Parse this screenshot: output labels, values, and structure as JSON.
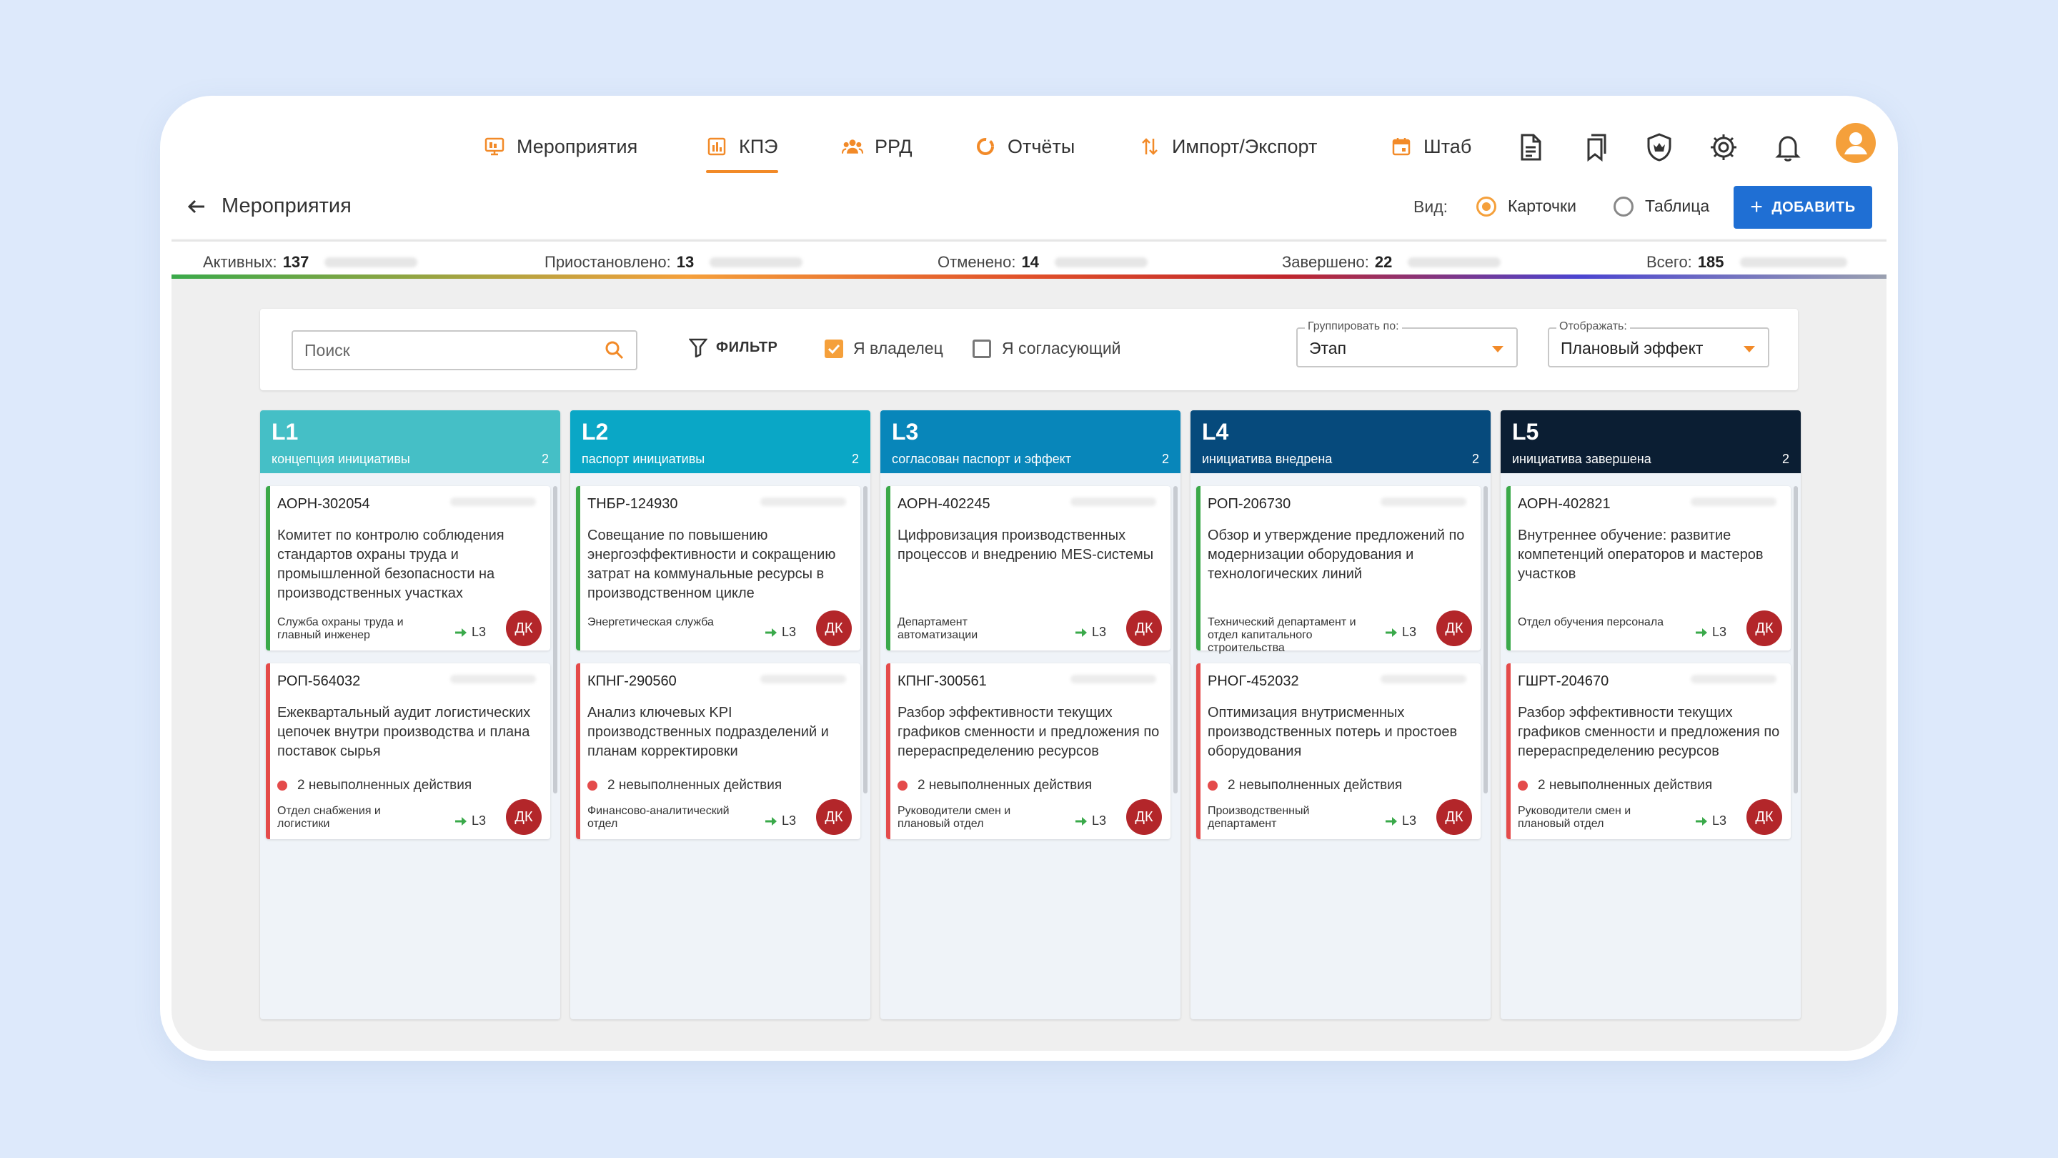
{
  "nav": {
    "items": [
      {
        "label": "Мероприятия",
        "icon": "monitor-icon"
      },
      {
        "label": "КПЭ",
        "icon": "bar-chart-icon"
      },
      {
        "label": "РРД",
        "icon": "team-icon"
      },
      {
        "label": "Отчёты",
        "icon": "pie-chart-icon"
      },
      {
        "label": "Импорт/Экспорт",
        "icon": "import-export-icon"
      },
      {
        "label": "Штаб",
        "icon": "calendar-icon"
      }
    ],
    "active": "КПЭ",
    "icons": [
      "document-icon",
      "bookmarks-icon",
      "shield-crown-icon",
      "settings-icon",
      "bell-icon",
      "user-avatar-icon"
    ]
  },
  "header": {
    "title": "Мероприятия",
    "view_label": "Вид:",
    "view_cards": "Карточки",
    "view_table": "Таблица",
    "view_selected": "Карточки",
    "add_button": "ДОБАВИТЬ"
  },
  "stats": [
    {
      "label": "Активных:",
      "value": "137"
    },
    {
      "label": "Приостановлено:",
      "value": "13"
    },
    {
      "label": "Отменено:",
      "value": "14"
    },
    {
      "label": "Завершено:",
      "value": "22"
    },
    {
      "label": "Всего:",
      "value": "185"
    }
  ],
  "filters": {
    "search_placeholder": "Поиск",
    "filter_button": "ФИЛЬТР",
    "owner_label": "Я владелец",
    "owner_checked": true,
    "approver_label": "Я согласующий",
    "approver_checked": false,
    "group_by_label": "Группировать по:",
    "group_by_value": "Этап",
    "display_label": "Отображать:",
    "display_value": "Плановый эффект"
  },
  "columns": [
    {
      "code": "L1",
      "subtitle": "концепция инициативы",
      "count": "2",
      "color": "#45bfc6",
      "cards": [
        {
          "code": "АОРН-302054",
          "desc": "Комитет по контролю соблюдения стандартов охраны труда и промышленной безопасности на производственных участках",
          "dept": "Служба охраны труда и главный инженер",
          "level": "L3",
          "avatar": "ДК",
          "status_color": "#3aa94a",
          "warning": ""
        },
        {
          "code": "РОП-564032",
          "desc": "Ежеквартальный аудит логистических цепочек внутри производства и плана поставок сырья",
          "dept": "Отдел снабжения и логистики",
          "level": "L3",
          "avatar": "ДК",
          "status_color": "#e44b4b",
          "warning": "2 невыполненных действия"
        }
      ]
    },
    {
      "code": "L2",
      "subtitle": "паспорт инициативы",
      "count": "2",
      "color": "#0aa7c6",
      "cards": [
        {
          "code": "ТНБР-124930",
          "desc": "Совещание по повышению энергоэффективности и сокращению затрат на коммунальные ресурсы в производственном цикле",
          "dept": "Энергетическая служба",
          "level": "L3",
          "avatar": "ДК",
          "status_color": "#3aa94a",
          "warning": ""
        },
        {
          "code": "КПНГ-290560",
          "desc": "Анализ ключевых KPI производственных подразделений и планам корректировки",
          "dept": "Финансово-аналитический отдел",
          "level": "L3",
          "avatar": "ДК",
          "status_color": "#e44b4b",
          "warning": "2 невыполненных действия"
        }
      ]
    },
    {
      "code": "L3",
      "subtitle": "согласован паспорт и эффект",
      "count": "2",
      "color": "#0886ba",
      "cards": [
        {
          "code": "АОРН-402245",
          "desc": "Цифровизация производственных процессов и внедрению MES-системы",
          "dept": "Департамент автоматизации",
          "level": "L3",
          "avatar": "ДК",
          "status_color": "#3aa94a",
          "warning": ""
        },
        {
          "code": "КПНГ-300561",
          "desc": "Разбор эффективности текущих графиков сменности и предложения по перераспределению ресурсов",
          "dept": "Руководители смен и плановый отдел",
          "level": "L3",
          "avatar": "ДК",
          "status_color": "#e44b4b",
          "warning": "2 невыполненных действия"
        }
      ]
    },
    {
      "code": "L4",
      "subtitle": "инициатива внедрена",
      "count": "2",
      "color": "#064a7c",
      "cards": [
        {
          "code": "РОП-206730",
          "desc": "Обзор и утверждение предложений по модернизации оборудования и технологических линий",
          "dept": "Технический департамент и отдел капитального строительства",
          "level": "L3",
          "avatar": "ДК",
          "status_color": "#3aa94a",
          "warning": ""
        },
        {
          "code": "РНОГ-452032",
          "desc": "Оптимизация внутрисменных производственных потерь и простоев оборудования",
          "dept": "Производственный департамент",
          "level": "L3",
          "avatar": "ДК",
          "status_color": "#e44b4b",
          "warning": "2 невыполненных действия"
        }
      ]
    },
    {
      "code": "L5",
      "subtitle": "инициатива завершена",
      "count": "2",
      "color": "#0b1e33",
      "cards": [
        {
          "code": "АОРН-402821",
          "desc": "Внутреннее обучение: развитие компетенций операторов и мастеров участков",
          "dept": "Отдел обучения персонала",
          "level": "L3",
          "avatar": "ДК",
          "status_color": "#3aa94a",
          "warning": ""
        },
        {
          "code": "ГШРТ-204670",
          "desc": "Разбор эффективности текущих графиков сменности и предложения по перераспределению ресурсов",
          "dept": "Руководители смен и плановый отдел",
          "level": "L3",
          "avatar": "ДК",
          "status_color": "#e44b4b",
          "warning": "2 невыполненных действия"
        }
      ]
    }
  ]
}
